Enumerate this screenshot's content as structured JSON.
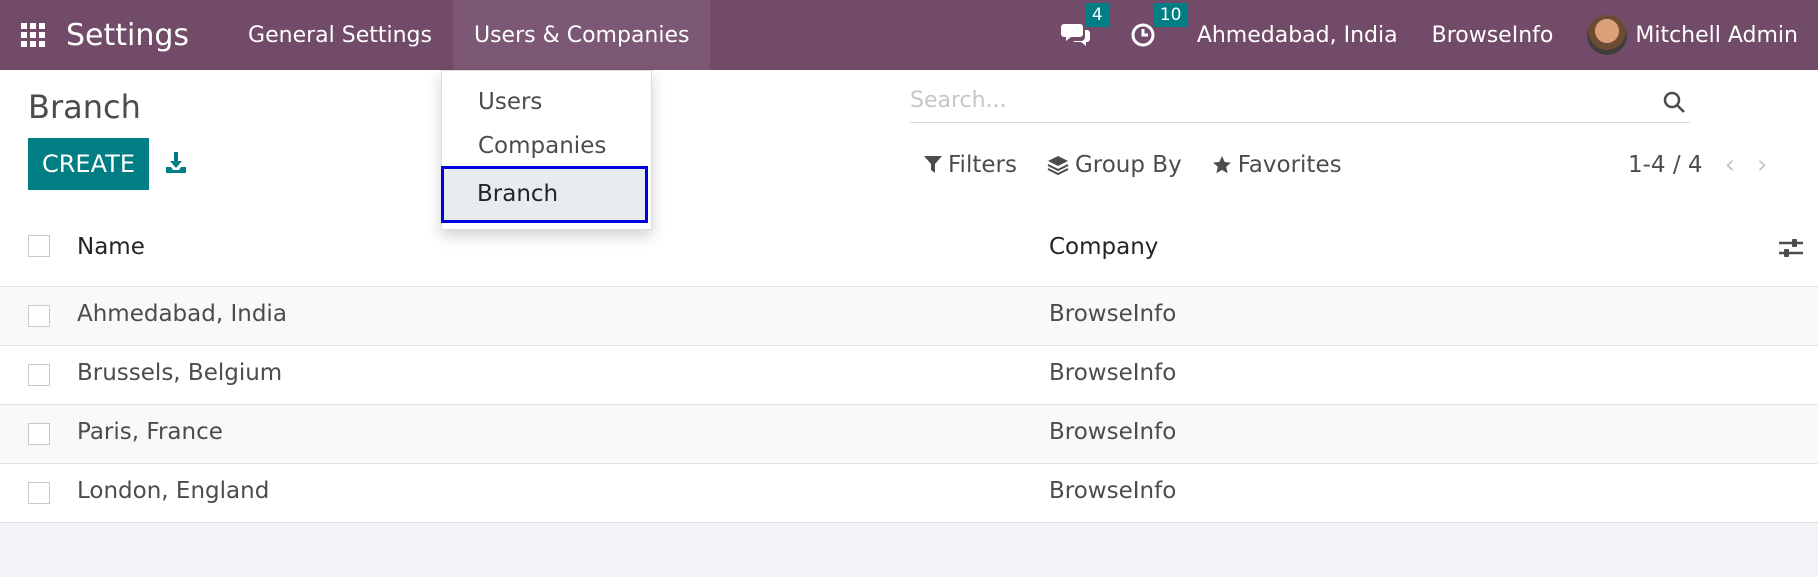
{
  "navbar": {
    "brand": "Settings",
    "menu": [
      {
        "label": "General Settings"
      },
      {
        "label": "Users & Companies"
      }
    ],
    "messages_count": "4",
    "activities_count": "10",
    "branch": "Ahmedabad, India",
    "company": "BrowseInfo",
    "user": "Mitchell Admin"
  },
  "page": {
    "title": "Branch",
    "create_label": "CREATE"
  },
  "search": {
    "placeholder": "Search..."
  },
  "filters": {
    "filters_label": "Filters",
    "groupby_label": "Group By",
    "favorites_label": "Favorites"
  },
  "pager": {
    "value": "1-4 / 4"
  },
  "table": {
    "headers": {
      "name": "Name",
      "company": "Company"
    },
    "rows": [
      {
        "name": "Ahmedabad, India",
        "company": "BrowseInfo"
      },
      {
        "name": "Brussels, Belgium",
        "company": "BrowseInfo"
      },
      {
        "name": "Paris, France",
        "company": "BrowseInfo"
      },
      {
        "name": "London, England",
        "company": "BrowseInfo"
      }
    ]
  },
  "dropdown": {
    "items": [
      {
        "label": "Users"
      },
      {
        "label": "Companies"
      },
      {
        "label": "Branch"
      }
    ]
  },
  "colors": {
    "navbar": "#714b67",
    "primary": "#017e84",
    "highlight_border": "#0000e0"
  }
}
